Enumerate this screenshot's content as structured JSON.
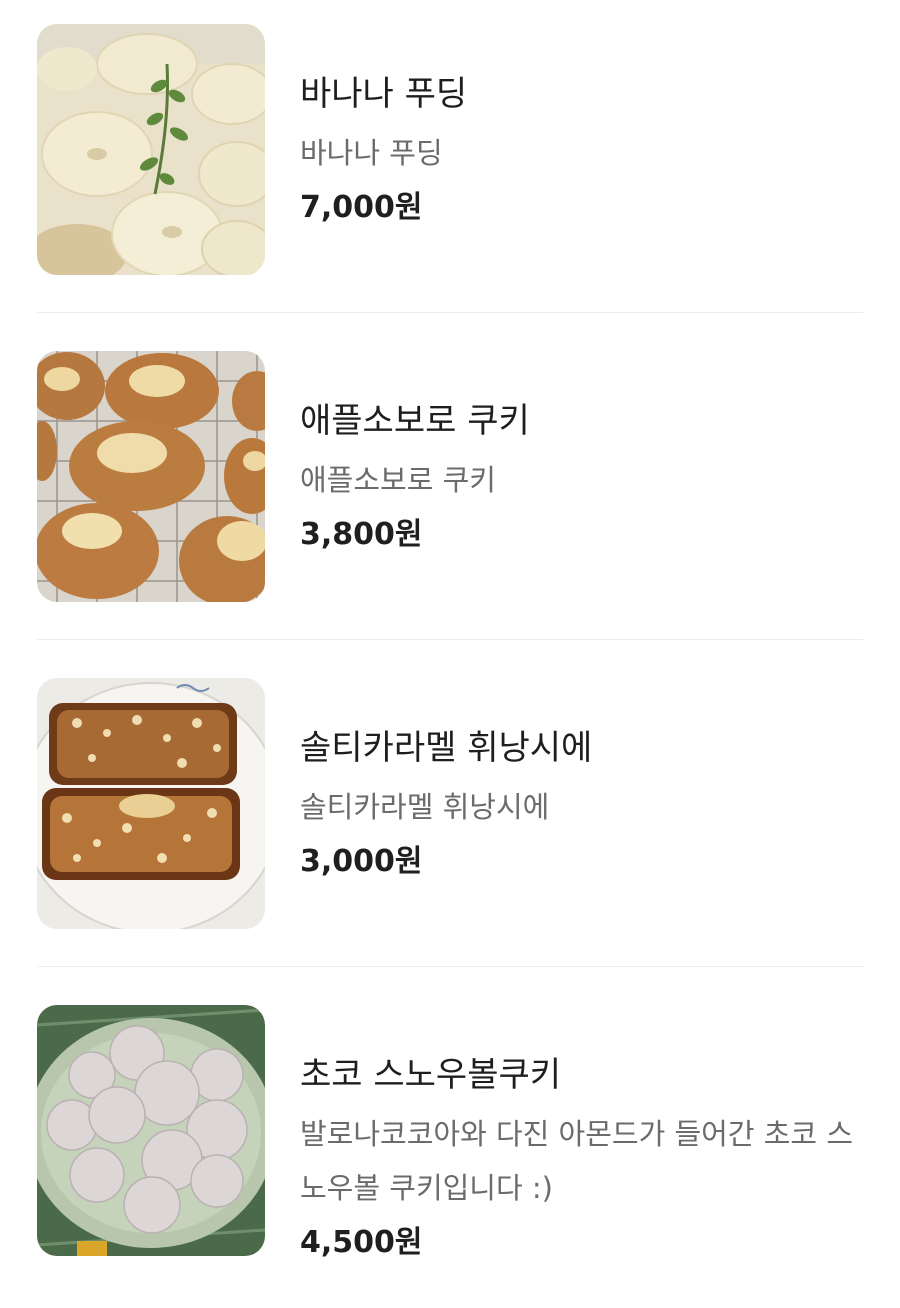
{
  "menu_items": [
    {
      "name": "바나나 푸딩",
      "description": "바나나 푸딩",
      "price": "7,000원",
      "image": "banana-pudding-photo"
    },
    {
      "name": "애플소보로 쿠키",
      "description": "애플소보로 쿠키",
      "price": "3,800원",
      "image": "apple-soboro-cookie-photo"
    },
    {
      "name": "솔티카라멜 휘낭시에",
      "description": "솔티카라멜 휘낭시에",
      "price": "3,000원",
      "image": "salty-caramel-financier-photo"
    },
    {
      "name": "초코 스노우볼쿠키",
      "description": "발로나코코아와 다진 아몬드가 들어간 초코 스노우볼 쿠키입니다 :)",
      "price": "4,500원",
      "image": "choco-snowball-cookie-photo"
    }
  ]
}
